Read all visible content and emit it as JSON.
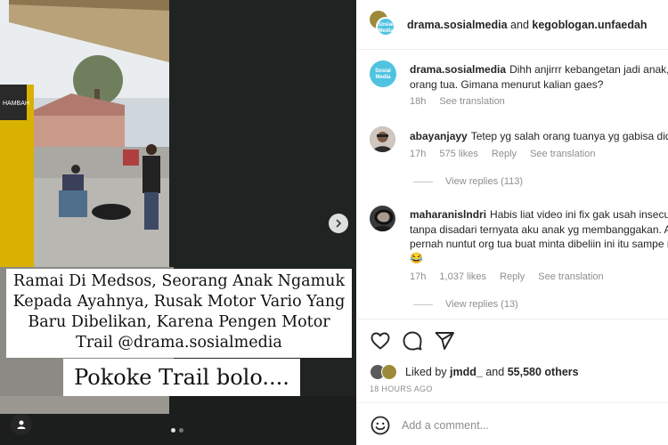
{
  "post": {
    "media": {
      "caption_lines": [
        "Ramai Di Medsos, Seorang Anak Ngamuk",
        "Kepada Ayahnya, Rusak Motor Vario Yang",
        "Baru Dibelikan, Karena Pengen Motor",
        "Trail @drama.sosialmedia"
      ],
      "subtitle": "Pokoke Trail bolo....",
      "sign_text": "HAMBAH",
      "page_count": 2,
      "active_page": 1,
      "next_icon": "chevron-right-icon",
      "tag_icon": "user-tag-icon"
    },
    "header": {
      "author": "drama.sosialmedia",
      "joiner": "and",
      "collaborator": "kegoblogan.unfaedah",
      "avatar_text": "Sosial Media"
    },
    "caption": {
      "user": "drama.sosialmedia",
      "text_line1": "Dihh anjirrr kebangetan jadi anak, gak tau terimakasih banget sama",
      "text_line2": "orang tua. Gimana menurut kalian gaes?",
      "time": "18h",
      "see_translation": "See translation"
    },
    "comments": [
      {
        "user": "abayanjayy",
        "text": "Tetep yg salah orang tuanya yg gabisa didik anak",
        "time": "17h",
        "likes": "575 likes",
        "reply": "Reply",
        "see_translation": "See translation",
        "view_replies": "View replies (113)"
      },
      {
        "user": "maharanislndri",
        "text_line1": "Habis liat video ini fix gak usah insecure lagi,",
        "text_line2": "tanpa disadari ternyata aku anak yg membanggakan. Aku aja",
        "text_line3": "pernah nuntut org tua buat minta dibeliin ini itu sampe ngamuk",
        "emoji": "😂",
        "time": "17h",
        "likes": "1,037 likes",
        "reply": "Reply",
        "see_translation": "See translation",
        "view_replies": "View replies (13)"
      }
    ],
    "actions": {
      "like_icon": "heart-icon",
      "comment_icon": "comment-icon",
      "share_icon": "share-icon"
    },
    "likes": {
      "prefix": "Liked by",
      "user": "jmdd_",
      "joiner": "and",
      "others": "55,580 others"
    },
    "timestamp": "18 HOURS AGO",
    "add_comment": {
      "placeholder": "Add a comment...",
      "emoji_icon": "smiley-icon"
    }
  }
}
